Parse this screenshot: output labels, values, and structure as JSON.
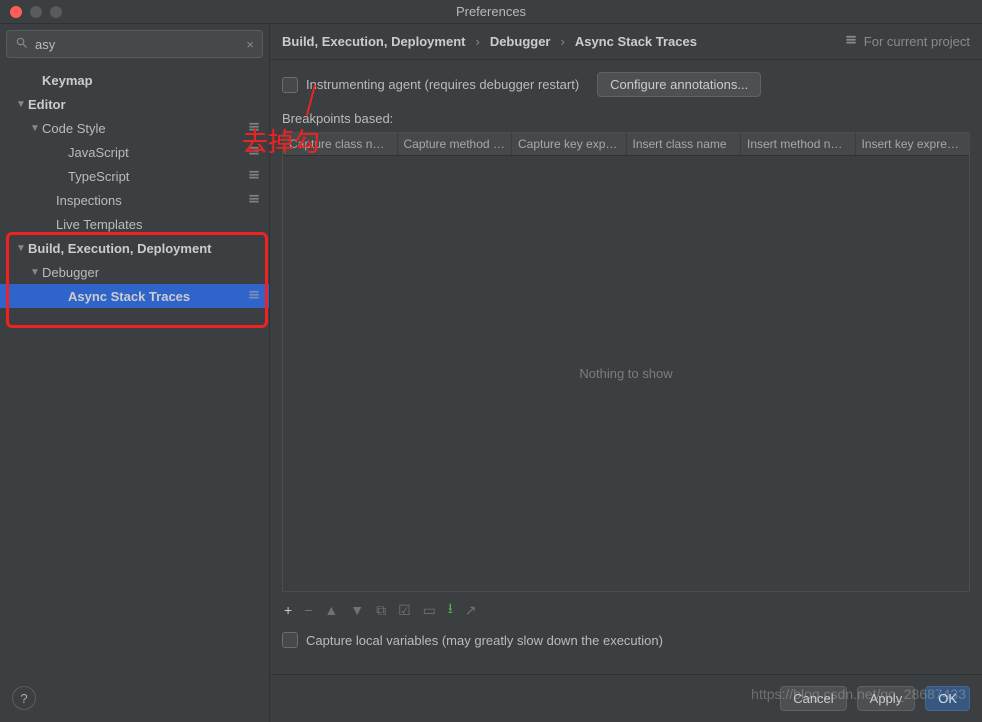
{
  "window": {
    "title": "Preferences"
  },
  "search": {
    "value": "asy"
  },
  "tree": [
    {
      "label": "Keymap",
      "bold": true,
      "indent": 28,
      "arrow": ""
    },
    {
      "label": "Editor",
      "bold": true,
      "indent": 14,
      "arrow": "▼"
    },
    {
      "label": "Code Style",
      "bold": false,
      "indent": 28,
      "arrow": "▼",
      "proj": true
    },
    {
      "label": "JavaScript",
      "bold": false,
      "indent": 54,
      "arrow": "",
      "proj": true
    },
    {
      "label": "TypeScript",
      "bold": false,
      "indent": 54,
      "arrow": "",
      "proj": true
    },
    {
      "label": "Inspections",
      "bold": false,
      "indent": 42,
      "arrow": "",
      "proj": true
    },
    {
      "label": "Live Templates",
      "bold": false,
      "indent": 42,
      "arrow": ""
    },
    {
      "label": "Build, Execution, Deployment",
      "bold": true,
      "indent": 14,
      "arrow": "▼"
    },
    {
      "label": "Debugger",
      "bold": false,
      "indent": 28,
      "arrow": "▼"
    },
    {
      "label": "Async Stack Traces",
      "bold": true,
      "indent": 54,
      "arrow": "",
      "proj": true,
      "selected": true
    }
  ],
  "breadcrumbs": [
    "Build, Execution, Deployment",
    "Debugger",
    "Async Stack Traces"
  ],
  "for_project": "For current project",
  "options": {
    "instrumenting": "Instrumenting agent (requires debugger restart)",
    "configure_btn": "Configure annotations...",
    "breakpoints_label": "Breakpoints based:",
    "capture_local": "Capture local variables (may greatly slow down the execution)"
  },
  "table": {
    "columns": [
      "Capture class name",
      "Capture method n...",
      "Capture key expre...",
      "Insert class name",
      "Insert method name",
      "Insert key expressi..."
    ],
    "empty_text": "Nothing to show"
  },
  "buttons": {
    "cancel": "Cancel",
    "apply": "Apply",
    "ok": "OK"
  },
  "annotation": "去掉勾",
  "watermark": "https://blog.csdn.net/qq_28687433"
}
